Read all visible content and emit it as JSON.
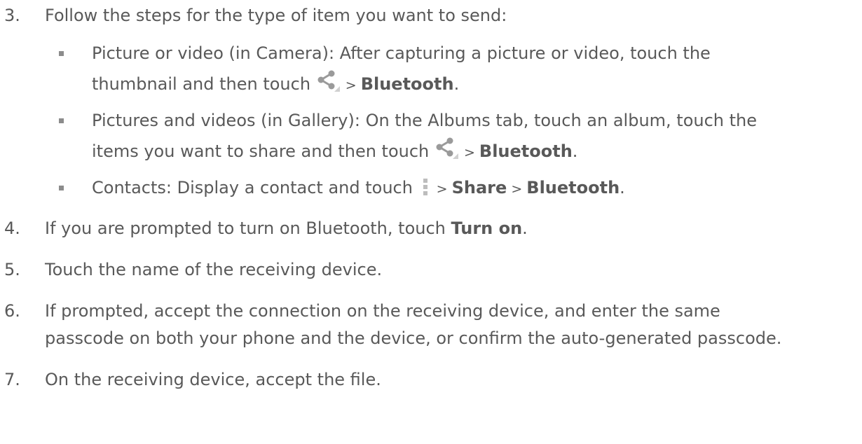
{
  "steps": [
    {
      "num": "3.",
      "text": "Follow the steps for the type of item you want to send:"
    },
    {
      "num": "4.",
      "text_pre": "If you are prompted to turn on Bluetooth, touch ",
      "bold": "Turn on",
      "text_post": "."
    },
    {
      "num": "5.",
      "text": "Touch the name of the receiving device."
    },
    {
      "num": "6.",
      "line1": "If prompted, accept the connection on the receiving device, and enter the same",
      "line2": "passcode on both your phone and the device, or confirm the auto-generated passcode."
    },
    {
      "num": "7.",
      "text": "On the receiving device, accept the file."
    }
  ],
  "substeps": [
    {
      "line1": "Picture or video (in Camera): After capturing a picture or video, touch the",
      "line2_pre": "thumbnail and then touch ",
      "sep": " > ",
      "bold": "Bluetooth",
      "post": "."
    },
    {
      "line1": "Pictures and videos (in Gallery): On the Albums tab, touch an album, touch the",
      "line2_pre": "items you want to share and then touch ",
      "sep": " > ",
      "bold": "Bluetooth",
      "post": "."
    },
    {
      "pre": "Contacts: Display a contact and touch ",
      "sep1": " > ",
      "bold1": "Share",
      "sep2": " > ",
      "bold2": "Bluetooth",
      "post": "."
    }
  ],
  "icons": {
    "share": "share-icon",
    "menu": "overflow-menu-icon"
  }
}
